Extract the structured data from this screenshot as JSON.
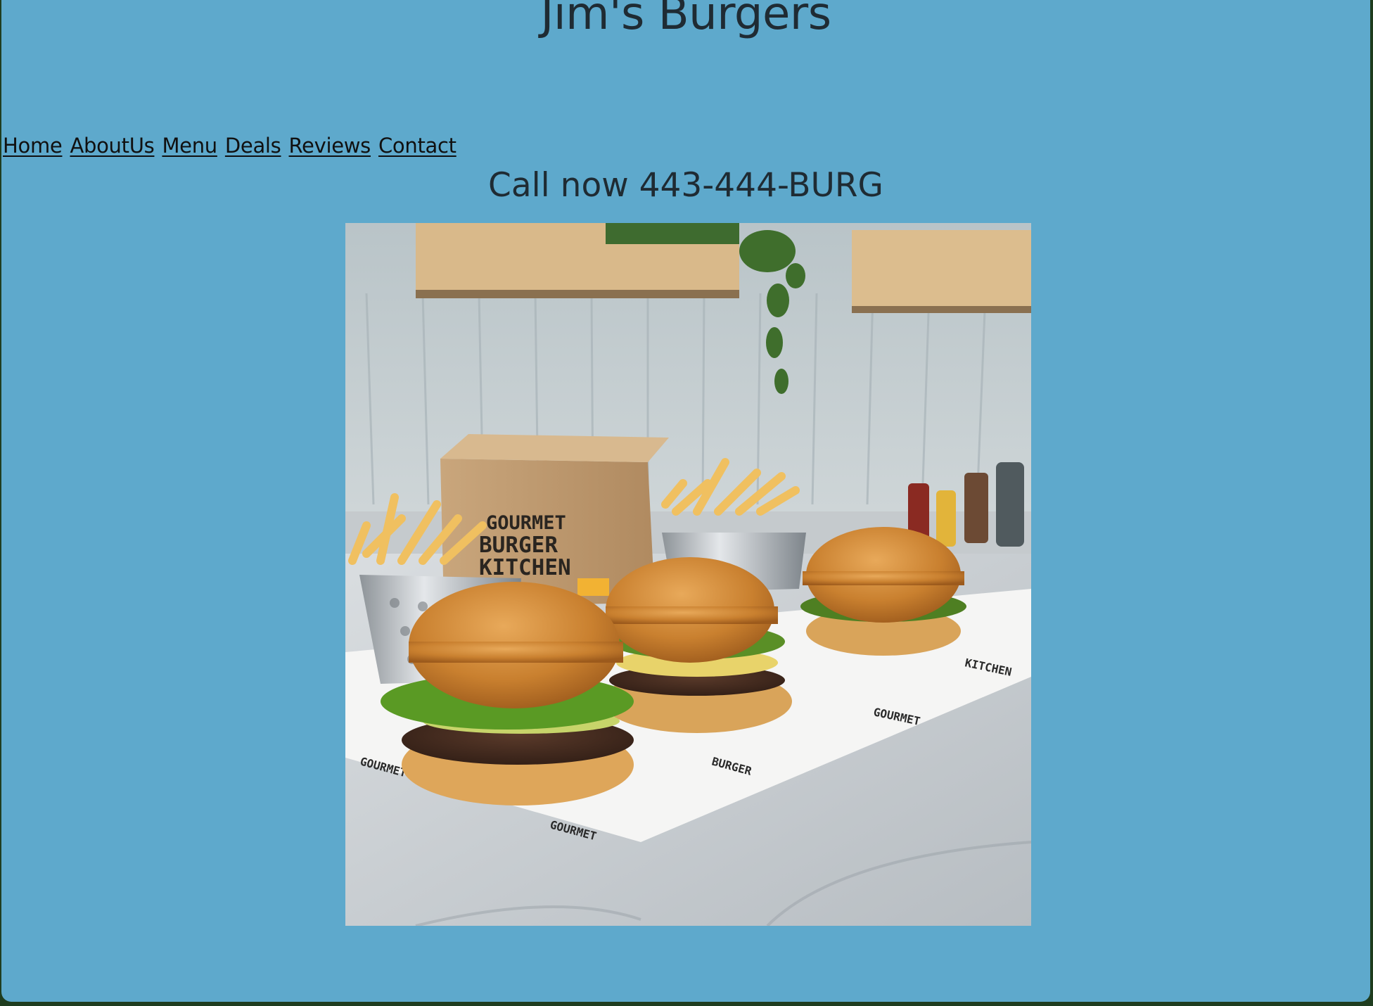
{
  "site": {
    "title": "Jim's Burgers",
    "call_now": "Call now 443-444-BURG"
  },
  "nav": {
    "items": [
      {
        "label": "Home"
      },
      {
        "label": "AboutUs"
      },
      {
        "label": "Menu"
      },
      {
        "label": "Deals"
      },
      {
        "label": "Reviews"
      },
      {
        "label": "Contact"
      }
    ]
  },
  "hero": {
    "box_brand": [
      "GOURMET",
      "BURGER",
      "KITCHEN"
    ],
    "paper_brand": "GOURMET BURGER KITCHEN"
  },
  "colors": {
    "page_background": "#5ea9cc",
    "text": "#1f2b33",
    "link": "#101010"
  }
}
